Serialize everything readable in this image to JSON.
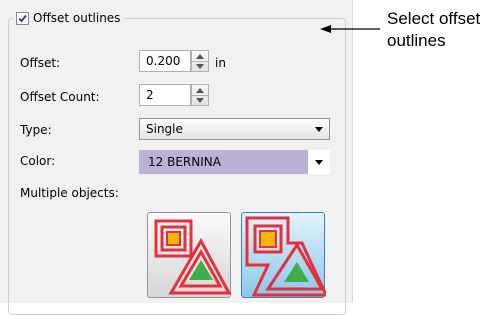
{
  "offset_outlines": {
    "label": "Offset outlines",
    "checked": true
  },
  "offset": {
    "label": "Offset:",
    "value": "0.200",
    "unit": "in"
  },
  "offset_count": {
    "label": "Offset Count:",
    "value": "2"
  },
  "type": {
    "label": "Type:",
    "selected": "Single"
  },
  "color": {
    "label": "Color:",
    "value": "12 BERNINA",
    "swatch": "#bdb2d6"
  },
  "multiple_objects": {
    "label": "Multiple objects:"
  },
  "callout": {
    "line1": "Select offset",
    "line2": "outlines"
  }
}
